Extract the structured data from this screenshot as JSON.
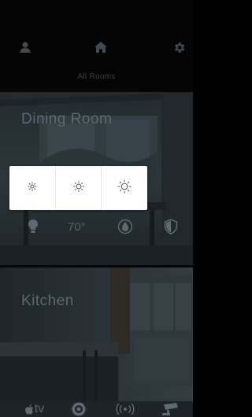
{
  "header": {
    "title": "All Rooms",
    "icons": [
      "user-icon",
      "home-icon",
      "gear-icon"
    ]
  },
  "rooms": [
    {
      "name": "Dining Room",
      "temperature": "70°",
      "controls": [
        "light-icon",
        "thermostat-icon",
        "shades-icon",
        "security-icon"
      ]
    },
    {
      "name": "Kitchen",
      "controls": [
        "apple-tv-icon",
        "music-icon",
        "radio-icon",
        "camera-icon"
      ]
    }
  ],
  "tv_label": "tv",
  "light_popover": {
    "levels": [
      "dim-icon",
      "medium-icon",
      "bright-icon"
    ]
  },
  "colors": {
    "background": "#000000",
    "popover": "#ffffff",
    "icon": "#5d6a71"
  }
}
